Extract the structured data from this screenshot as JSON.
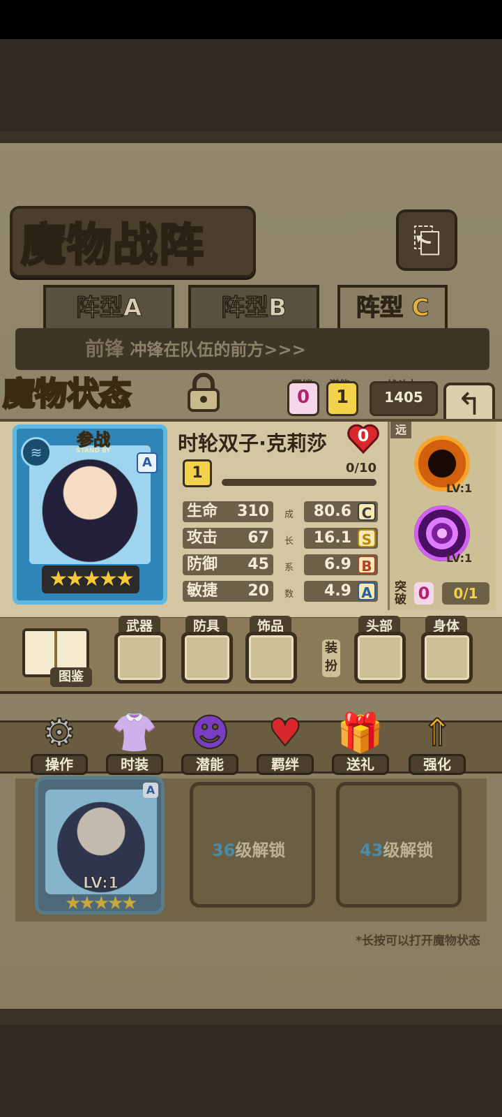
{
  "screen_title": "魔物战阵",
  "formation_tabs": [
    {
      "label": "阵型A"
    },
    {
      "label": "阵型B"
    },
    {
      "label_main": "阵型",
      "label_letter": "C"
    }
  ],
  "frontline": {
    "label": "前锋",
    "desc": "冲锋在队伍的前方>>>"
  },
  "status_panel": {
    "title": "魔物状态",
    "bond": {
      "label": "羁绊",
      "value": "0"
    },
    "potential": {
      "label": "潜能",
      "value": "1"
    },
    "power": {
      "label": "战斗力",
      "value": "1405"
    }
  },
  "monster": {
    "badge_top": "参战",
    "badge_sub": "STAND BY",
    "rank_letter": "A",
    "name": "时轮双子·克莉莎",
    "heart_value": "0",
    "level": "1",
    "exp": "0/10",
    "exp_fraction": 0.0,
    "stars": "★★★★★",
    "range": "远",
    "skills": [
      {
        "level": "LV:1"
      },
      {
        "level": "LV:1"
      }
    ],
    "breakthrough": {
      "label": "突破",
      "value": "0",
      "progress": "0/1"
    },
    "stats": [
      {
        "label": "生命",
        "value": "310",
        "coef": "80.6",
        "grade": "C",
        "grade_color": "#3a3a3a"
      },
      {
        "label": "攻击",
        "value": "67",
        "coef": "16.1",
        "grade": "S",
        "grade_color": "#b58a00"
      },
      {
        "label": "防御",
        "value": "45",
        "coef": "6.9",
        "grade": "B",
        "grade_color": "#b0442a"
      },
      {
        "label": "敏捷",
        "value": "20",
        "coef": "4.9",
        "grade": "A",
        "grade_color": "#2b5c9c"
      }
    ],
    "coef_vertical": [
      "成",
      "长",
      "系",
      "数"
    ]
  },
  "equipment": {
    "codex_label": "图鉴",
    "slots": [
      "武器",
      "防具",
      "饰品",
      "头部",
      "身体"
    ],
    "dress_label": "装扮"
  },
  "menu": [
    "操作",
    "时装",
    "潜能",
    "羁绊",
    "送礼",
    "强化"
  ],
  "team": {
    "member_level": "LV:1",
    "member_rank": "A",
    "member_stars": "★★★★★",
    "locked": [
      {
        "num": "36",
        "text": "级解锁"
      },
      {
        "num": "43",
        "text": "级解锁"
      }
    ]
  },
  "hint": "*长按可以打开魔物状态",
  "colors": {
    "accent_gold": "#e0b23a",
    "heart_red": "#d8282c",
    "card_blue": "#2f84b8"
  }
}
